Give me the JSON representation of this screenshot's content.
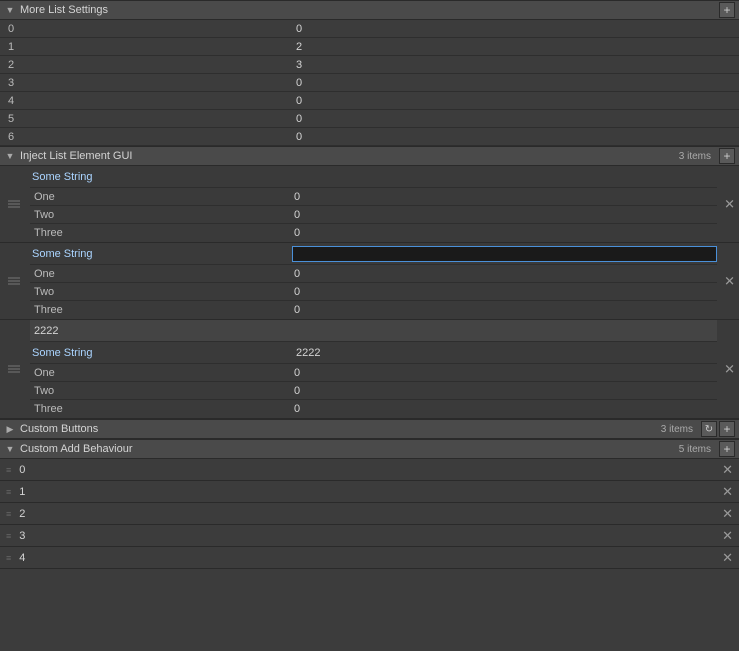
{
  "moreListSettings": {
    "title": "More List Settings",
    "rows": [
      {
        "key": "0",
        "value": "0"
      },
      {
        "key": "1",
        "value": "2"
      },
      {
        "key": "2",
        "value": "3"
      },
      {
        "key": "3",
        "value": "0"
      },
      {
        "key": "4",
        "value": "0"
      },
      {
        "key": "5",
        "value": "0"
      },
      {
        "key": "6",
        "value": "0"
      }
    ]
  },
  "injectListGUI": {
    "title": "Inject List Element GUI",
    "count": "3 items",
    "items": [
      {
        "stringLabel": "Some String",
        "stringValue": "",
        "active": false,
        "subRows": [
          {
            "key": "One",
            "value": "0"
          },
          {
            "key": "Two",
            "value": "0"
          },
          {
            "key": "Three",
            "value": "0"
          }
        ]
      },
      {
        "stringLabel": "Some String",
        "stringValue": "",
        "active": true,
        "subRows": [
          {
            "key": "One",
            "value": "0"
          },
          {
            "key": "Two",
            "value": "0"
          },
          {
            "key": "Three",
            "value": "0"
          }
        ]
      },
      {
        "bannerValue": "2222",
        "stringLabel": "Some String",
        "stringValue": "2222",
        "active": false,
        "subRows": [
          {
            "key": "One",
            "value": "0"
          },
          {
            "key": "Two",
            "value": "0"
          },
          {
            "key": "Three",
            "value": "0"
          }
        ]
      }
    ]
  },
  "customButtons": {
    "title": "Custom Buttons",
    "count": "3 items"
  },
  "customAddBehaviour": {
    "title": "Custom Add Behaviour",
    "count": "5 items",
    "rows": [
      {
        "label": "0"
      },
      {
        "label": "1"
      },
      {
        "label": "2"
      },
      {
        "label": "3"
      },
      {
        "label": "4"
      }
    ]
  }
}
